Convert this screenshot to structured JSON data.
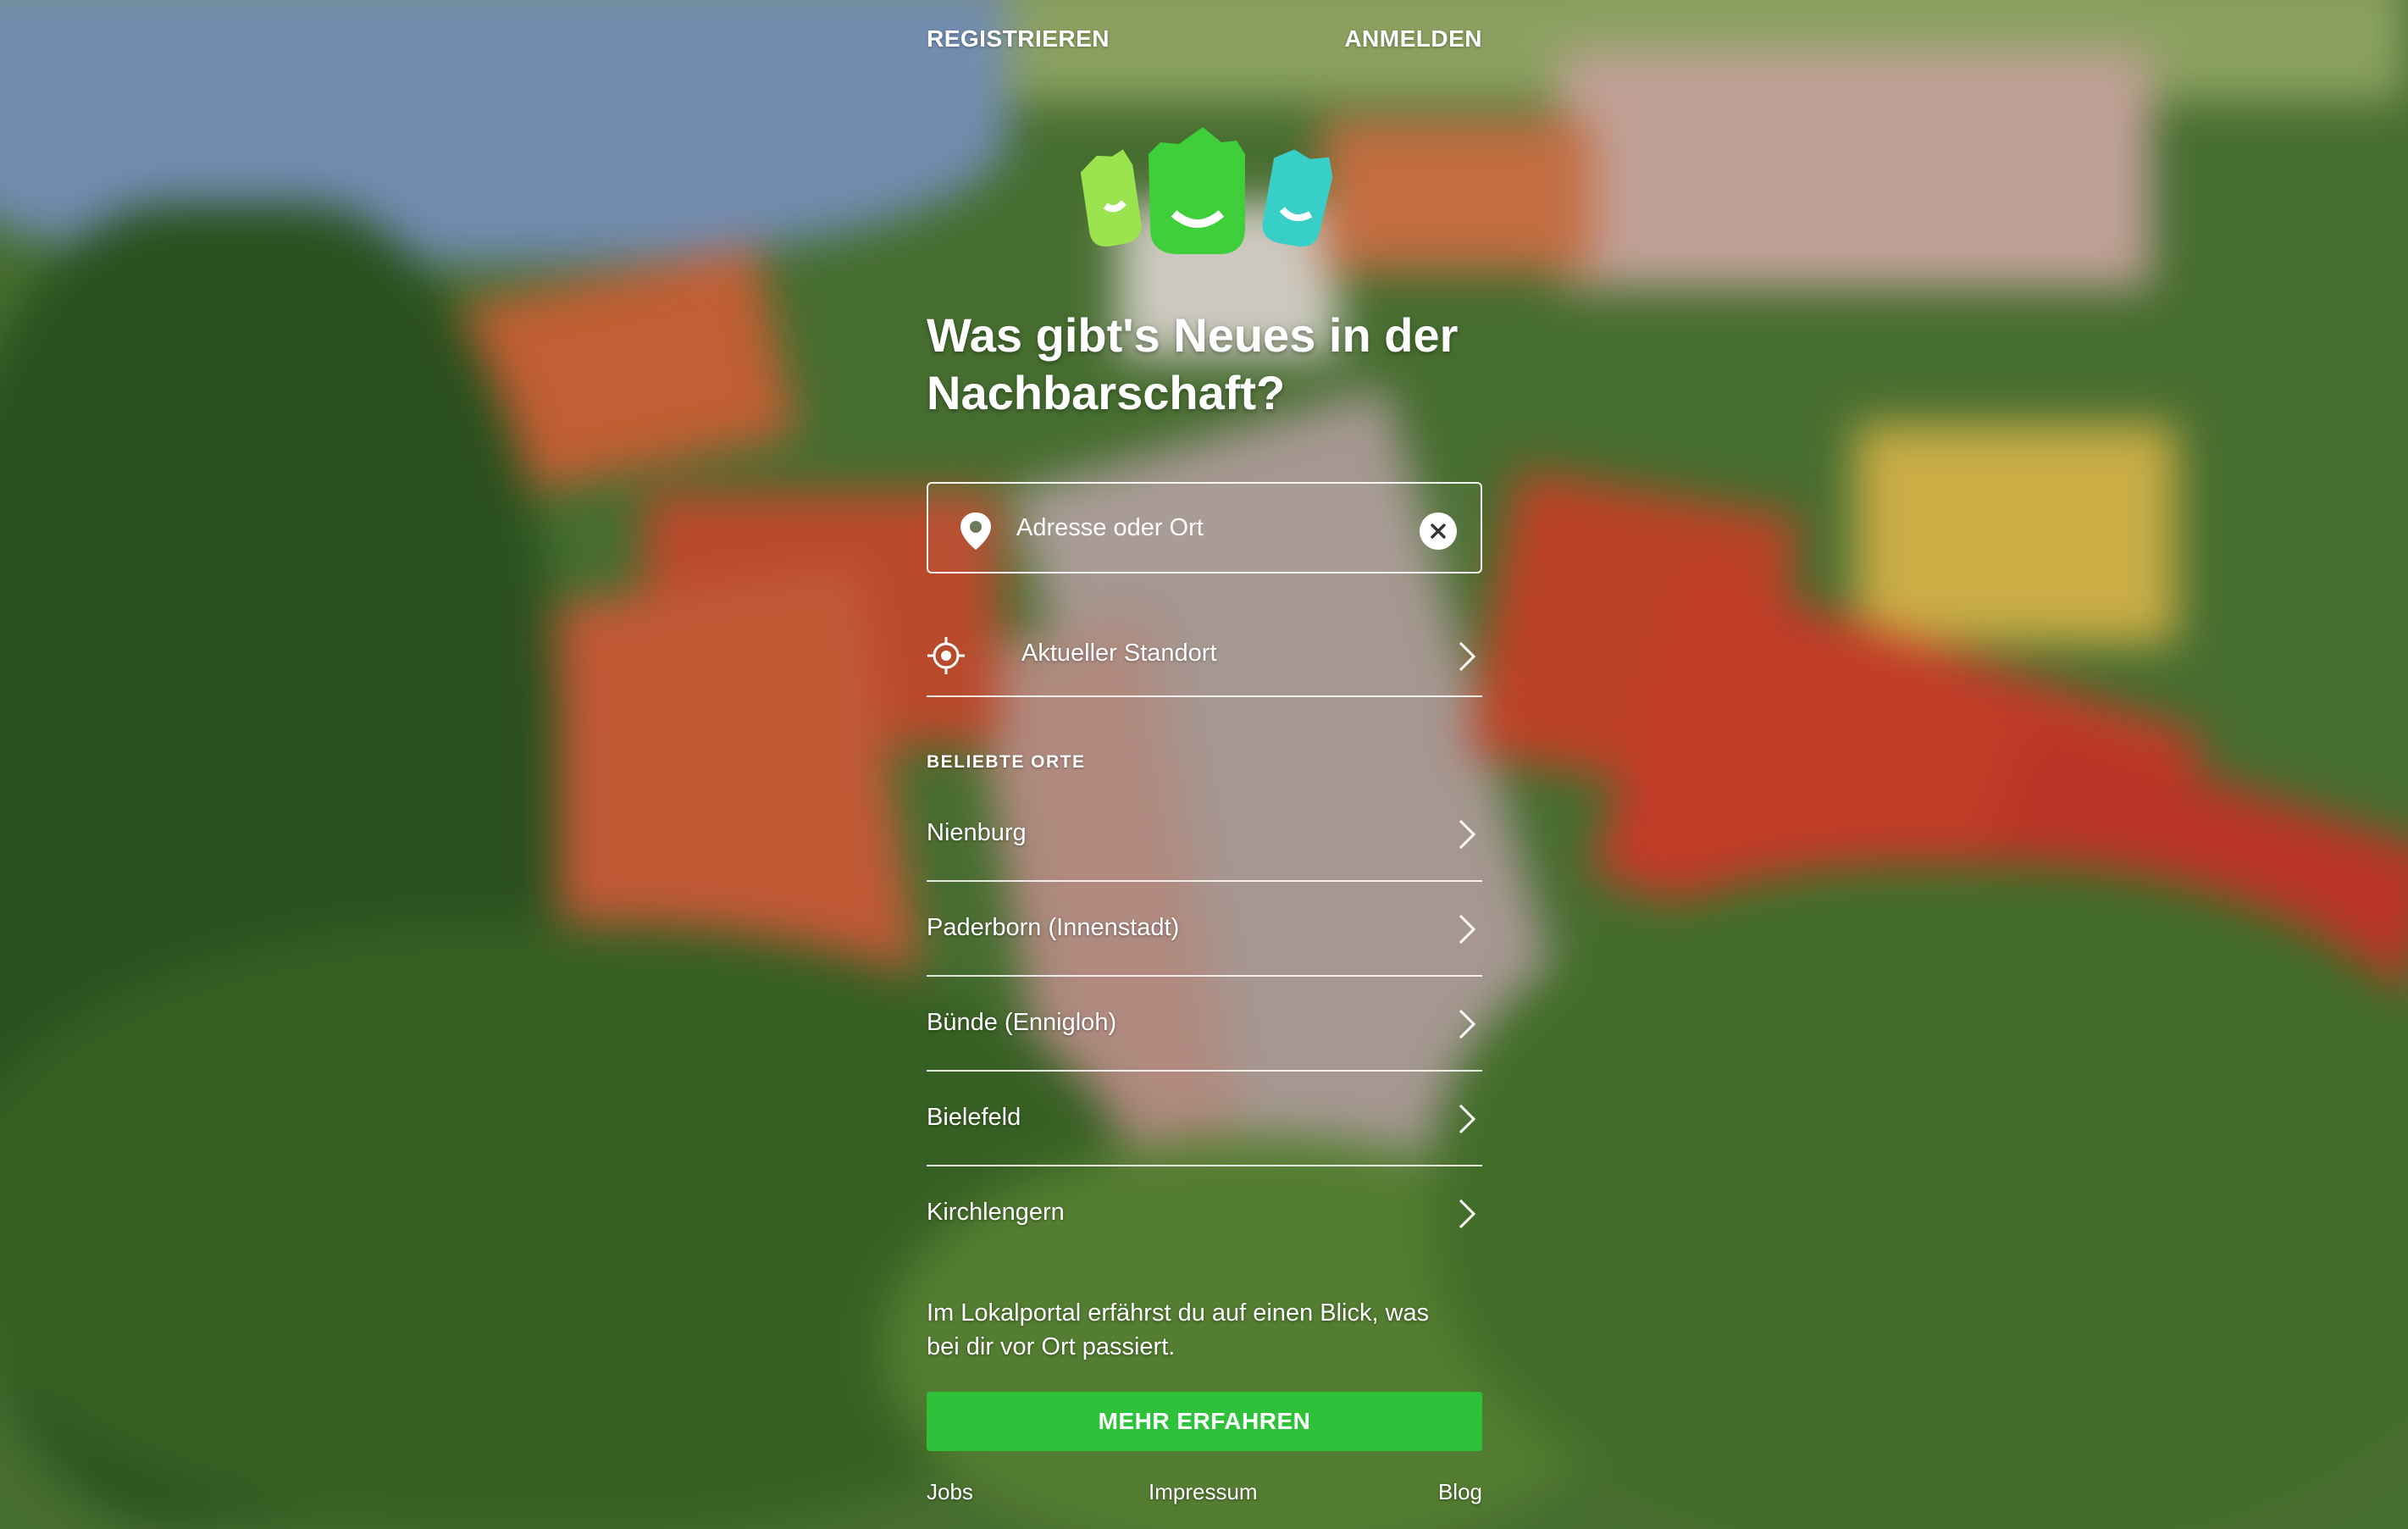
{
  "nav": {
    "register_label": "REGISTRIEREN",
    "login_label": "ANMELDEN"
  },
  "logo": {
    "colors": [
      "#9be34f",
      "#3fcf3a",
      "#37cfc6"
    ],
    "icon": "three-houses-logo"
  },
  "hero": {
    "headline_line1": "Was gibt's Neues in der",
    "headline_line2": "Nachbarschaft?"
  },
  "search": {
    "placeholder": "Adresse oder Ort",
    "value": "",
    "pin_icon": "map-pin-icon",
    "clear_icon": "close-circle-icon"
  },
  "current_location": {
    "label": "Aktueller Standort",
    "icon": "crosshair-icon"
  },
  "popular": {
    "heading": "BELIEBTE ORTE",
    "items": [
      {
        "label": "Nienburg"
      },
      {
        "label": "Paderborn (Innenstadt)"
      },
      {
        "label": "Bünde (Ennigloh)"
      },
      {
        "label": "Bielefeld"
      },
      {
        "label": "Kirchlengern"
      }
    ]
  },
  "info": {
    "text_line1": "Im Lokalportal erfährst du auf einen Blick, was",
    "text_line2": "bei dir vor Ort passiert."
  },
  "cta": {
    "label": "MEHR ERFAHREN",
    "color": "#2ec23a"
  },
  "footer": {
    "jobs_label": "Jobs",
    "imprint_label": "Impressum",
    "blog_label": "Blog"
  }
}
